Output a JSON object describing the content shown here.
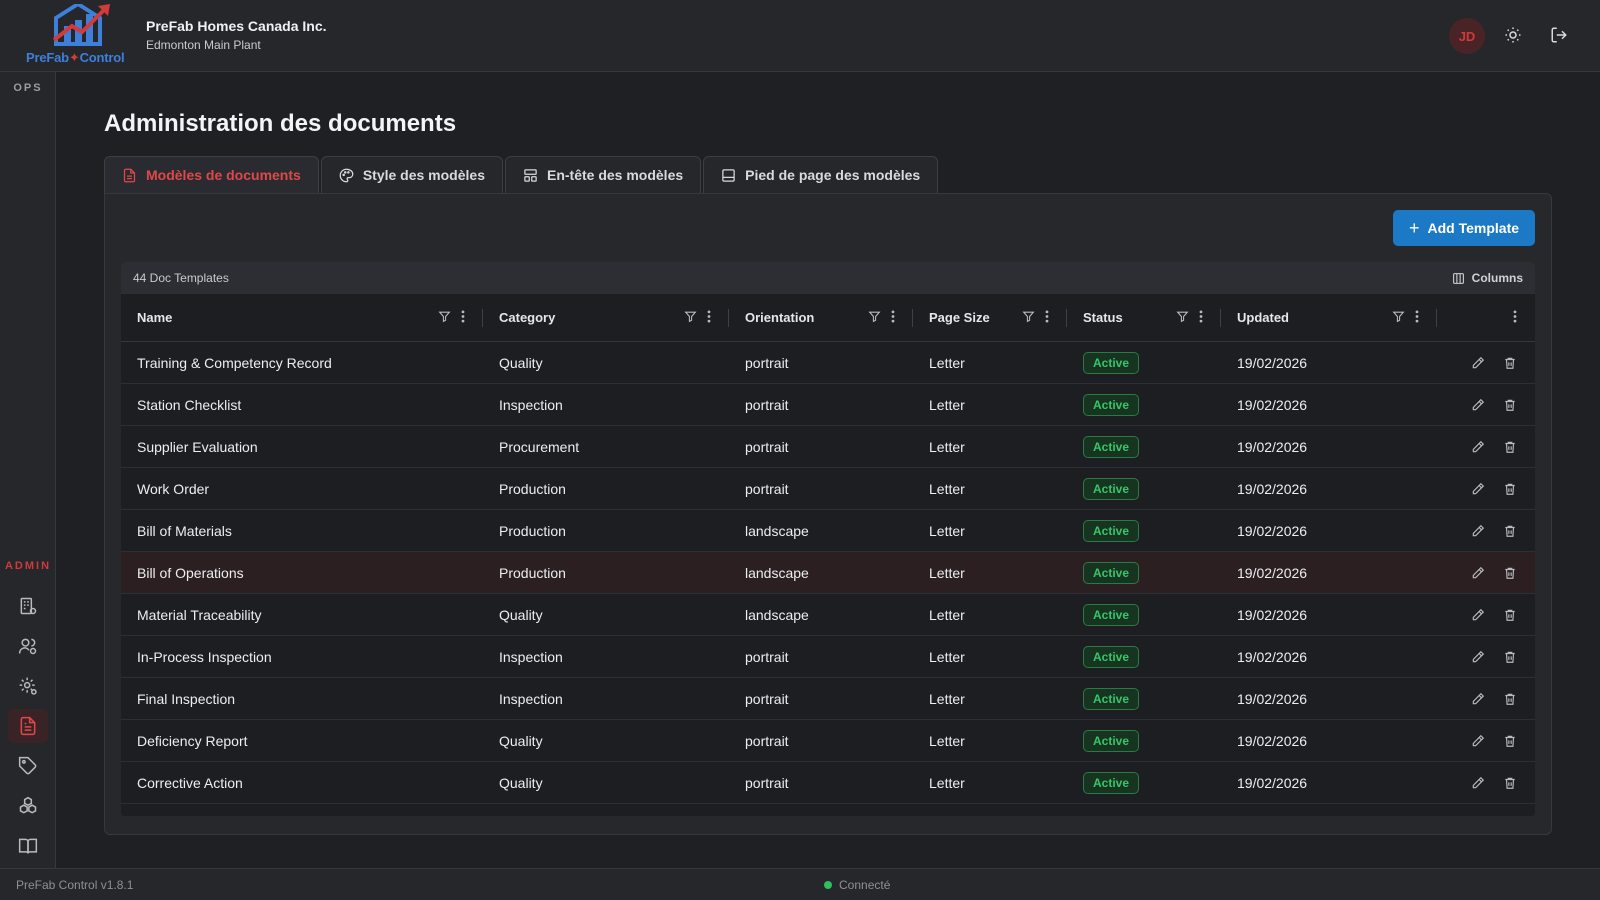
{
  "header": {
    "logo_text_a": "PreFab",
    "logo_text_star": "✦",
    "logo_text_b": "Control",
    "company_name": "PreFab Homes Canada Inc.",
    "plant_name": "Edmonton Main Plant",
    "user_initials": "JD",
    "icons": [
      "sun-icon",
      "logout-icon"
    ]
  },
  "sidebar": {
    "section_ops": "OPS",
    "section_admin": "ADMIN",
    "items": [
      {
        "icon": "building-settings-icon"
      },
      {
        "icon": "users-settings-icon"
      },
      {
        "icon": "gear-icon"
      },
      {
        "icon": "document-icon",
        "active": true
      },
      {
        "icon": "tag-settings-icon"
      },
      {
        "icon": "components-settings-icon"
      },
      {
        "icon": "book-settings-icon"
      }
    ]
  },
  "page": {
    "title": "Administration des documents"
  },
  "tabs": [
    {
      "label": "Modèles de documents",
      "icon": "document-icon",
      "active": true
    },
    {
      "label": "Style des modèles",
      "icon": "palette-icon",
      "active": false
    },
    {
      "label": "En-tête des modèles",
      "icon": "layout-header-icon",
      "active": false
    },
    {
      "label": "Pied de page des modèles",
      "icon": "layout-footer-icon",
      "active": false
    }
  ],
  "toolbar": {
    "add_label": "Add Template"
  },
  "grid": {
    "count_label": "44 Doc Templates",
    "columns_label": "Columns",
    "headers": [
      "Name",
      "Category",
      "Orientation",
      "Page Size",
      "Status",
      "Updated"
    ],
    "rows": [
      {
        "name": "Training & Competency Record",
        "category": "Quality",
        "orientation": "portrait",
        "page_size": "Letter",
        "status": "Active",
        "updated": "19/02/2026"
      },
      {
        "name": "Station Checklist",
        "category": "Inspection",
        "orientation": "portrait",
        "page_size": "Letter",
        "status": "Active",
        "updated": "19/02/2026"
      },
      {
        "name": "Supplier Evaluation",
        "category": "Procurement",
        "orientation": "portrait",
        "page_size": "Letter",
        "status": "Active",
        "updated": "19/02/2026"
      },
      {
        "name": "Work Order",
        "category": "Production",
        "orientation": "portrait",
        "page_size": "Letter",
        "status": "Active",
        "updated": "19/02/2026"
      },
      {
        "name": "Bill of Materials",
        "category": "Production",
        "orientation": "landscape",
        "page_size": "Letter",
        "status": "Active",
        "updated": "19/02/2026"
      },
      {
        "name": "Bill of Operations",
        "category": "Production",
        "orientation": "landscape",
        "page_size": "Letter",
        "status": "Active",
        "updated": "19/02/2026",
        "selected": true
      },
      {
        "name": "Material Traceability",
        "category": "Quality",
        "orientation": "landscape",
        "page_size": "Letter",
        "status": "Active",
        "updated": "19/02/2026"
      },
      {
        "name": "In-Process Inspection",
        "category": "Inspection",
        "orientation": "portrait",
        "page_size": "Letter",
        "status": "Active",
        "updated": "19/02/2026"
      },
      {
        "name": "Final Inspection",
        "category": "Inspection",
        "orientation": "portrait",
        "page_size": "Letter",
        "status": "Active",
        "updated": "19/02/2026"
      },
      {
        "name": "Deficiency Report",
        "category": "Quality",
        "orientation": "portrait",
        "page_size": "Letter",
        "status": "Active",
        "updated": "19/02/2026"
      },
      {
        "name": "Corrective Action",
        "category": "Quality",
        "orientation": "portrait",
        "page_size": "Letter",
        "status": "Active",
        "updated": "19/02/2026"
      }
    ]
  },
  "footer": {
    "version": "PreFab Control v1.8.1",
    "connection": "Connecté"
  },
  "colors": {
    "accent_red": "#e04848",
    "primary_blue": "#1b79c6",
    "status_green": "#36c569"
  }
}
